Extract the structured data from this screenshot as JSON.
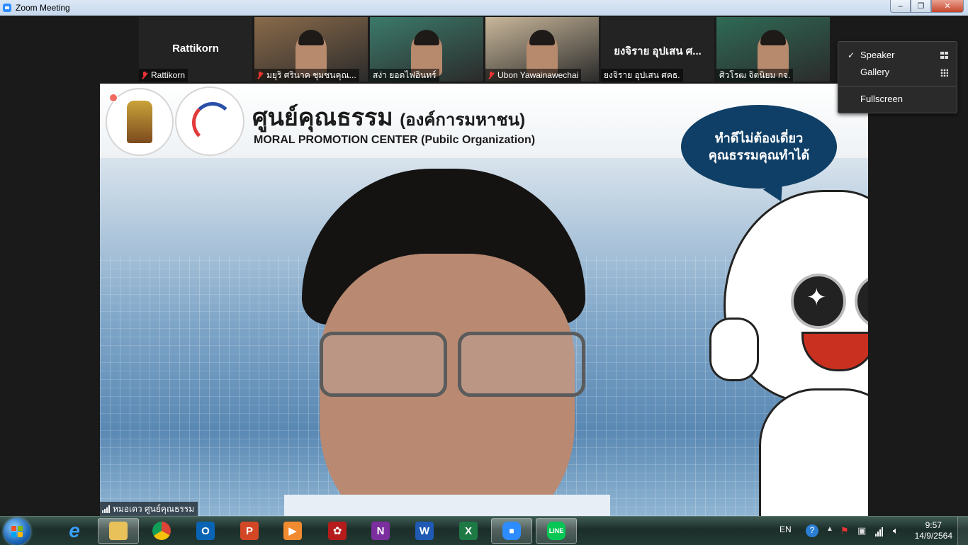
{
  "window": {
    "title": "Zoom Meeting",
    "controls": {
      "minimize": "–",
      "restore": "❐",
      "close": "✕"
    }
  },
  "thumbnails": [
    {
      "display_name": "Rattikorn",
      "label": "Rattikorn",
      "muted": true,
      "video": false
    },
    {
      "display_name": "",
      "label": "มยุริ ศรินาค ชุมชนคุณ...",
      "muted": true,
      "video": true,
      "bg": "#8a6a4a"
    },
    {
      "display_name": "",
      "label": "สง่า ยอดไฟอินทร์",
      "muted": false,
      "video": true,
      "bg": "#3b7a6a"
    },
    {
      "display_name": "",
      "label": "Ubon Yawainawechai",
      "muted": true,
      "video": true,
      "bg": "#c9b79a"
    },
    {
      "display_name": "ยงจิราย อุปเสน ศ...",
      "label": "ยงจิราย อุปเสน ศคธ.",
      "muted": false,
      "video": false
    },
    {
      "display_name": "",
      "label": "ศิวโรฒ จิตนิยม กจ.",
      "muted": false,
      "video": true,
      "bg": "#2f6a55"
    }
  ],
  "main_video": {
    "speaker_label": "หมอเดว ศูนย์คุณธรรม",
    "org_name_thai": "ศูนย์คุณธรรม",
    "org_type_thai": "(องค์การมหาชน)",
    "org_name_en": "MORAL PROMOTION CENTER",
    "org_type_en": "(Pubilc Organization)",
    "bubble_line1": "ทำดีไม่ต้องเดี่ยว",
    "bubble_line2": "คุณธรรมคุณทำได้"
  },
  "view_menu": {
    "items": [
      {
        "label": "Speaker",
        "checked": true
      },
      {
        "label": "Gallery",
        "checked": false
      },
      {
        "label": "Fullscreen",
        "checked": false
      }
    ]
  },
  "taskbar": {
    "apps": [
      {
        "name": "internet-explorer",
        "glyph": "e",
        "color": "#1e88e5"
      },
      {
        "name": "file-explorer",
        "glyph": "",
        "color": "#e8c15a"
      },
      {
        "name": "chrome",
        "glyph": "",
        "color": "#db4437"
      },
      {
        "name": "outlook",
        "glyph": "O",
        "color": "#0a64b5"
      },
      {
        "name": "powerpoint",
        "glyph": "P",
        "color": "#d24726"
      },
      {
        "name": "media-player",
        "glyph": "▶",
        "color": "#f28b30"
      },
      {
        "name": "game-app",
        "glyph": "✿",
        "color": "#b71c1c"
      },
      {
        "name": "onenote",
        "glyph": "N",
        "color": "#7b2f9e"
      },
      {
        "name": "word",
        "glyph": "W",
        "color": "#1f5bb5"
      },
      {
        "name": "excel",
        "glyph": "X",
        "color": "#1d7a45"
      },
      {
        "name": "zoom",
        "glyph": "■",
        "color": "#2d8cff"
      },
      {
        "name": "line",
        "glyph": "LINE",
        "color": "#06c755"
      }
    ],
    "language": "EN",
    "time": "9:57",
    "date": "14/9/2564"
  }
}
